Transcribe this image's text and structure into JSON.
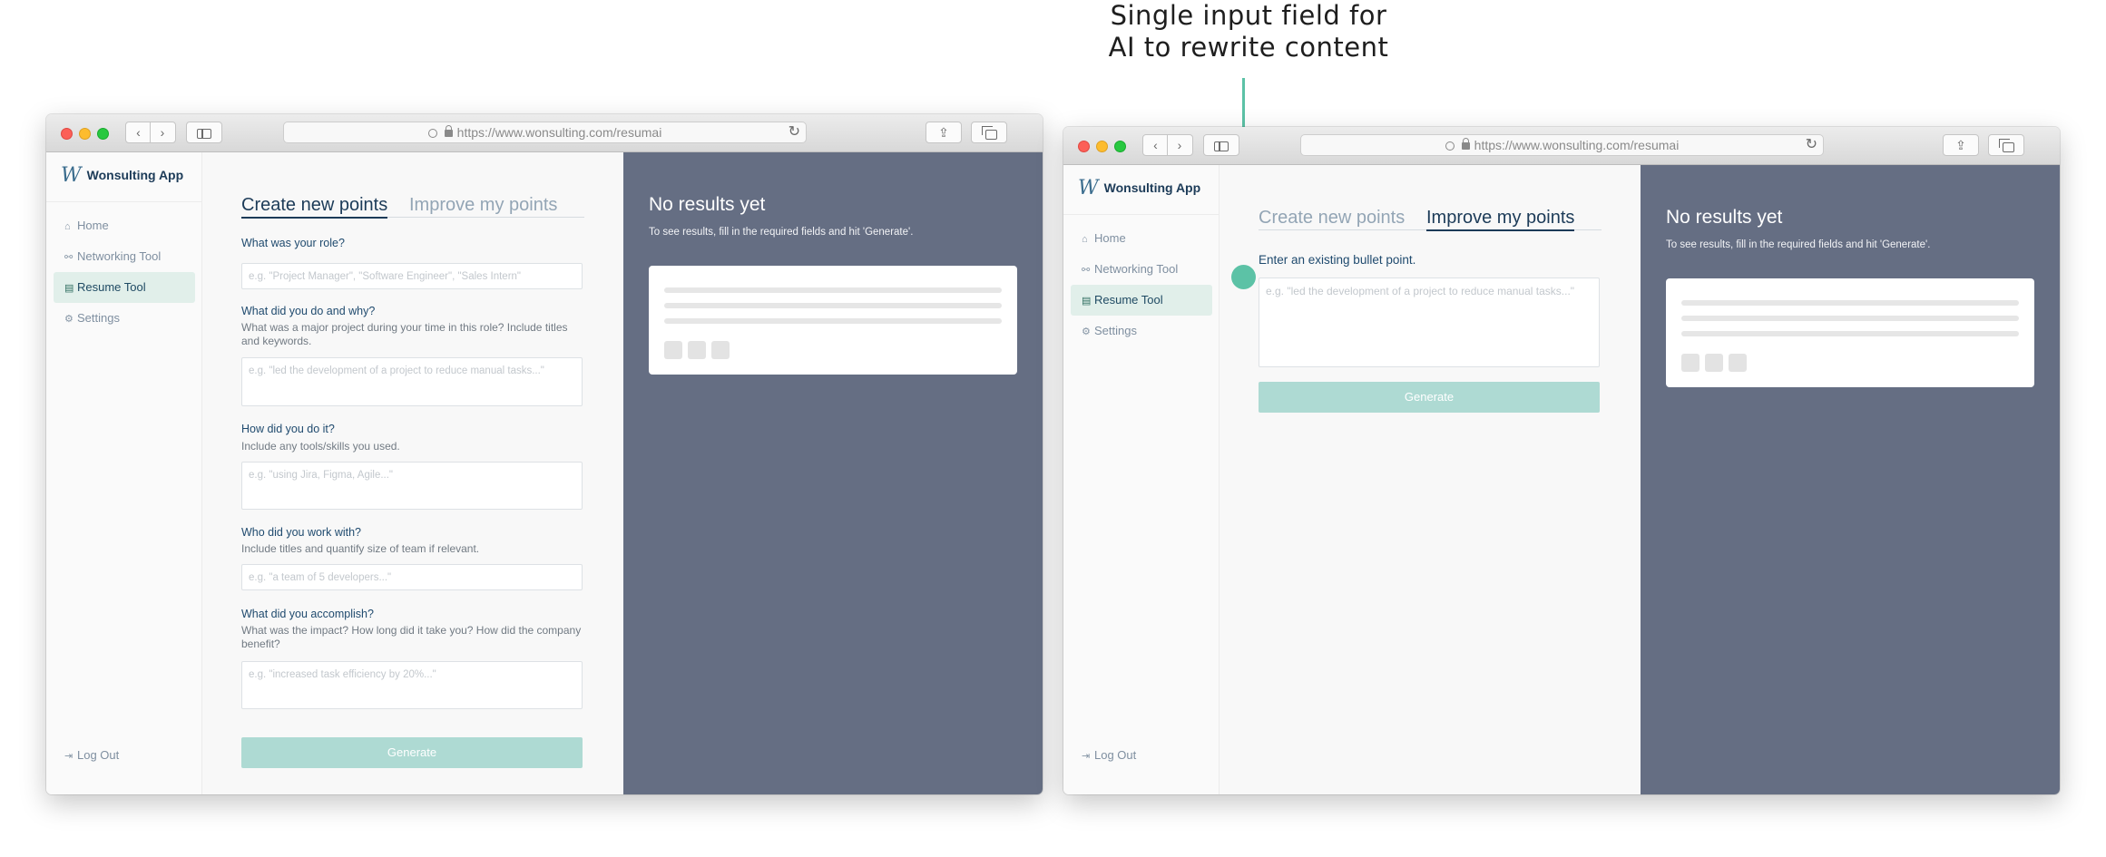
{
  "annotation": {
    "line1": "Single input field for",
    "line2": "AI to rewrite content"
  },
  "browser": {
    "url": "https://www.wonsulting.com/resumai",
    "back_glyph": "‹",
    "forward_glyph": "›",
    "share_glyph": "⇪",
    "reload_glyph": "↻"
  },
  "app": {
    "logo_mark": "W",
    "name": "Wonsulting App",
    "nav": [
      {
        "label": "Home",
        "icon": "home-icon",
        "glyph": "⌂"
      },
      {
        "label": "Networking Tool",
        "icon": "network-icon",
        "glyph": "⚯"
      },
      {
        "label": "Resume Tool",
        "icon": "document-icon",
        "glyph": "▤"
      },
      {
        "label": "Settings",
        "icon": "gear-icon",
        "glyph": "⚙"
      }
    ],
    "logout": {
      "label": "Log Out",
      "icon": "logout-icon",
      "glyph": "⇥"
    }
  },
  "tabs": {
    "create": "Create new points",
    "improve": "Improve my points"
  },
  "create_form": {
    "questions": [
      {
        "label": "What was your role?",
        "help": "",
        "placeholder": "e.g. \"Project Manager\", \"Software Engineer\", \"Sales Intern\""
      },
      {
        "label": "What did you do and why?",
        "help": "What was a major project during your time in this role? Include titles and keywords.",
        "placeholder": "e.g. \"led the development of a project to reduce manual tasks...\""
      },
      {
        "label": "How did you do it?",
        "help": "Include any tools/skills you used.",
        "placeholder": "e.g. \"using Jira, Figma, Agile...\""
      },
      {
        "label": "Who did you work with?",
        "help": "Include titles and quantify size of team if relevant.",
        "placeholder": "e.g. \"a team of 5 developers...\""
      },
      {
        "label": "What did you accomplish?",
        "help": "What was the impact? How long did it take you? How did the company benefit?",
        "placeholder": "e.g. \"increased task efficiency by 20%...\""
      }
    ],
    "generate": "Generate"
  },
  "improve_form": {
    "label": "Enter an existing bullet point.",
    "placeholder": "e.g. \"led the development of a project to reduce manual tasks...\"",
    "generate": "Generate"
  },
  "results": {
    "title": "No results yet",
    "subtitle": "To see results, fill in the required fields and hit 'Generate'."
  },
  "colors": {
    "accent": "#5cc2a6",
    "navy": "#1c3b58",
    "results_bg": "#656e83",
    "generate_bg": "#aedad3",
    "active_nav_bg": "#e1efea"
  }
}
